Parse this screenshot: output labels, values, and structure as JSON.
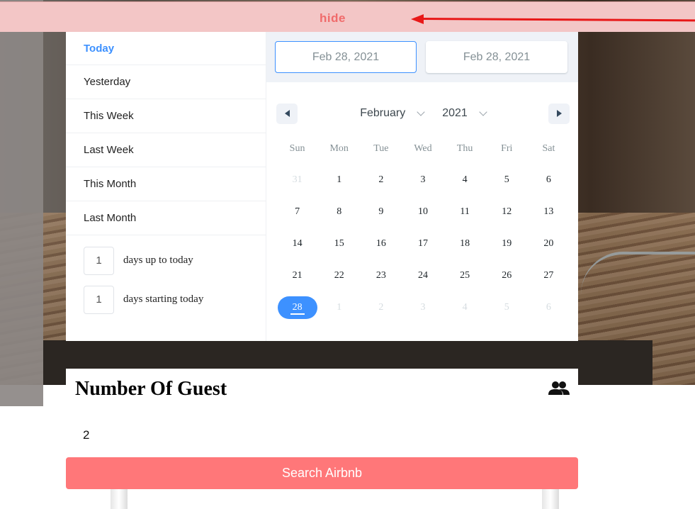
{
  "hide_bar": {
    "label": "hide"
  },
  "range_picker": {
    "static_ranges": [
      {
        "label": "Today",
        "active": true
      },
      {
        "label": "Yesterday"
      },
      {
        "label": "This Week"
      },
      {
        "label": "Last Week"
      },
      {
        "label": "This Month"
      },
      {
        "label": "Last Month"
      }
    ],
    "input_ranges": [
      {
        "value": "1",
        "label": "days up to today"
      },
      {
        "value": "1",
        "label": "days starting today"
      }
    ],
    "start_date": "Feb 28, 2021",
    "end_date": "Feb 28, 2021",
    "month": "February",
    "year": "2021",
    "weekdays": [
      "Sun",
      "Mon",
      "Tue",
      "Wed",
      "Thu",
      "Fri",
      "Sat"
    ],
    "days": [
      {
        "n": "31",
        "passive": true
      },
      {
        "n": "1"
      },
      {
        "n": "2"
      },
      {
        "n": "3"
      },
      {
        "n": "4"
      },
      {
        "n": "5"
      },
      {
        "n": "6"
      },
      {
        "n": "7"
      },
      {
        "n": "8"
      },
      {
        "n": "9"
      },
      {
        "n": "10"
      },
      {
        "n": "11"
      },
      {
        "n": "12"
      },
      {
        "n": "13"
      },
      {
        "n": "14"
      },
      {
        "n": "15"
      },
      {
        "n": "16"
      },
      {
        "n": "17"
      },
      {
        "n": "18"
      },
      {
        "n": "19"
      },
      {
        "n": "20"
      },
      {
        "n": "21"
      },
      {
        "n": "22"
      },
      {
        "n": "23"
      },
      {
        "n": "24"
      },
      {
        "n": "25"
      },
      {
        "n": "26"
      },
      {
        "n": "27"
      },
      {
        "n": "28",
        "selected": true
      },
      {
        "n": "1",
        "passive": true
      },
      {
        "n": "2",
        "passive": true
      },
      {
        "n": "3",
        "passive": true
      },
      {
        "n": "4",
        "passive": true
      },
      {
        "n": "5",
        "passive": true
      },
      {
        "n": "6",
        "passive": true
      }
    ]
  },
  "guests": {
    "title": "Number Of Guest",
    "icon": "people-icon",
    "value": "2"
  },
  "search": {
    "label": "Search Airbnb"
  },
  "colors": {
    "accent": "#3d91ff",
    "button": "#ff7779",
    "hide_bar_bg": "#f3c6c6",
    "hide_text": "#f06b6b",
    "arrow": "#e81818"
  }
}
